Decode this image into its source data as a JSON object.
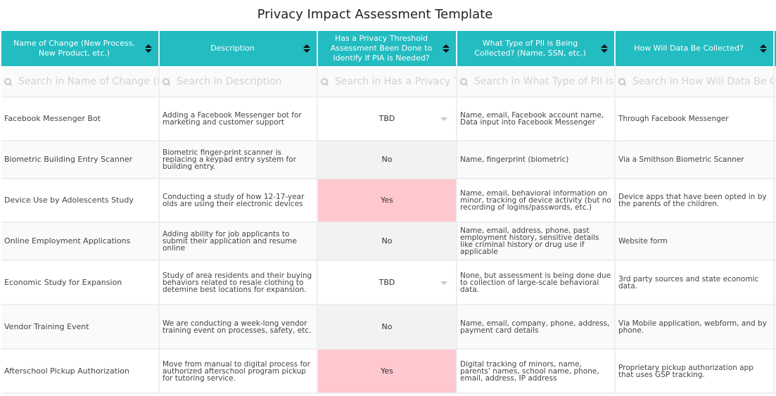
{
  "title": "Privacy Impact Assessment Template",
  "columns": [
    {
      "label": "Name of Change (New Process, New Product, etc.)",
      "search_placeholder": "Search in Name of Change (New Process, New Product, etc.)"
    },
    {
      "label": "Description",
      "search_placeholder": "Search in Description"
    },
    {
      "label": "Has a Privacy Threshold Assessment Been Done to Identify If PIA is Needed?",
      "search_placeholder": "Search in Has a Privacy Threshold Assessment Been Done to Identify If PIA is Needed?"
    },
    {
      "label": "What Type of PII is Being Collected? (Name, SSN, etc.)",
      "search_placeholder": "Search in What Type of PII is Being Collected? (Name, SSN, etc.)"
    },
    {
      "label": "How Will Data Be Collected?",
      "search_placeholder": "Search in How Will Data Be Collected?"
    }
  ],
  "status_colors": {
    "Yes": "#ffc7ce",
    "No": "#f2f2f2",
    "TBD": "#ffffff"
  },
  "header_color": "#22bcc1",
  "rows": [
    {
      "name": "Facebook Messenger Bot",
      "description": "Adding a Facebook Messenger bot for marketing and customer support",
      "pta": "TBD",
      "pii": "Name, email, Facebook account name, Data input into Facebook Messenger",
      "collection": "Through Facebook Messenger"
    },
    {
      "name": "Biometric Building Entry Scanner",
      "description": "Biometric finger-print scanner is replacing a keypad entry system for building entry.",
      "pta": "No",
      "pii": "Name, fingerprint (biometric)",
      "collection": "Via a Smithson Biometric Scanner"
    },
    {
      "name": "Device Use by Adolescents Study",
      "description": "Conducting a study of how 12-17-year olds are using their electronic devices",
      "pta": "Yes",
      "pii": "Name, email, behavioral information on minor, tracking of device activity (but no recording of logins/passwords, etc.)",
      "collection": "Device apps that have been opted in by the parents of the children."
    },
    {
      "name": "Online Employment Applications",
      "description": "Adding ability for job applicants to submit their application and resume online",
      "pta": "No",
      "pii": "Name, email, address, phone, past employment history, sensitive details like criminal history or drug use if applicable",
      "collection": "Website form"
    },
    {
      "name": "Economic Study for Expansion",
      "description": "Study of area residents and their buying behaviors related to resale clothing to detemine best locations for expansion.",
      "pta": "TBD",
      "pii": "None, but assessment is being done due to collection of large-scale behavioral data.",
      "collection": "3rd party sources and state economic data."
    },
    {
      "name": "Vendor Training Event",
      "description": "We are conducting a week-long vendor training event on processes, safety, etc.",
      "pta": "No",
      "pii": "Name, email, company, phone, address, payment card details",
      "collection": "Via Mobile application, webform, and by phone."
    },
    {
      "name": "Afterschool Pickup Authorization",
      "description": "Move from manual to digital process for authorized afterschool program pickup for tutoring service.",
      "pta": "Yes",
      "pii": "Digital tracking of minors, name, parents' names, school name, phone, email, address, IP address",
      "collection": "Proprietary pickup authorization app that uses GSP tracking."
    }
  ]
}
